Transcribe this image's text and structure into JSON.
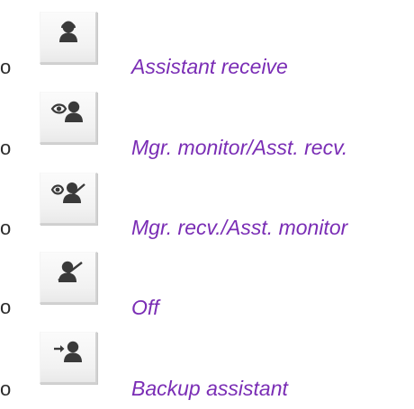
{
  "options": [
    {
      "icon": "person-headset-icon",
      "label": "Assistant receive"
    },
    {
      "icon": "eye-person-headset-icon",
      "label": "Mgr. monitor/Asst. recv."
    },
    {
      "icon": "eye-person-headset-slash-icon",
      "label": "Mgr. recv./Asst. monitor"
    },
    {
      "icon": "person-headset-slash-icon",
      "label": "Off"
    },
    {
      "icon": "arrow-person-headset-icon",
      "label": "Backup assistant"
    }
  ],
  "bullet_char": "o",
  "colors": {
    "label": "#7a2db5",
    "icon": "#3a3a3a"
  }
}
